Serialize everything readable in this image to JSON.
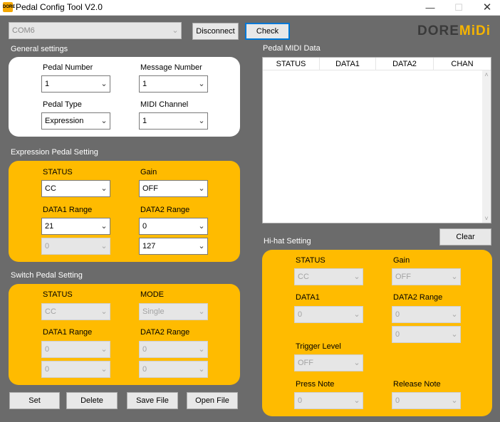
{
  "window": {
    "title": "Pedal Config Tool V2.0",
    "icon_text": "DORE",
    "minimize": "—",
    "maximize": "☐",
    "close": "✕"
  },
  "toolbar": {
    "com_port": "COM6",
    "disconnect_label": "Disconnect",
    "check_label": "Check"
  },
  "logo": {
    "part1": "DORE",
    "part2": "MiDi"
  },
  "general": {
    "title": "General settings",
    "pedal_number_label": "Pedal Number",
    "pedal_number_value": "1",
    "message_number_label": "Message Number",
    "message_number_value": "1",
    "pedal_type_label": "Pedal Type",
    "pedal_type_value": "Expression",
    "midi_channel_label": "MIDI Channel",
    "midi_channel_value": "1"
  },
  "expression": {
    "title": "Expression Pedal Setting",
    "status_label": "STATUS",
    "status_value": "CC",
    "gain_label": "Gain",
    "gain_value": "OFF",
    "data1_label": "DATA1 Range",
    "data1_min": "21",
    "data1_max": "0",
    "data2_label": "DATA2 Range",
    "data2_min": "0",
    "data2_max": "127"
  },
  "switch": {
    "title": "Switch Pedal Setting",
    "status_label": "STATUS",
    "status_value": "CC",
    "mode_label": "MODE",
    "mode_value": "Single",
    "data1_label": "DATA1 Range",
    "data1_min": "0",
    "data1_max": "0",
    "data2_label": "DATA2 Range",
    "data2_min": "0",
    "data2_max": "0"
  },
  "actions": {
    "set": "Set",
    "delete": "Delete",
    "save_file": "Save File",
    "open_file": "Open File"
  },
  "midi_data": {
    "title": "Pedal MIDI Data",
    "columns": [
      "STATUS",
      "DATA1",
      "DATA2",
      "CHAN"
    ],
    "scroll_up": "˄",
    "scroll_down": "˅",
    "clear_label": "Clear"
  },
  "hihat": {
    "title": "Hi-hat Setting",
    "status_label": "STATUS",
    "status_value": "CC",
    "gain_label": "Gain",
    "gain_value": "OFF",
    "data1_label": "DATA1",
    "data1_value": "0",
    "data2_label": "DATA2 Range",
    "data2_min": "0",
    "data2_max": "0",
    "trigger_label": "Trigger Level",
    "trigger_value": "OFF",
    "press_label": "Press Note",
    "press_value": "0",
    "release_label": "Release Note",
    "release_value": "0"
  },
  "combo_arrow": "⌄",
  "colors": {
    "panel_yellow": "#ffbb00",
    "background": "#6b6b6b",
    "logo_accent": "#f6b400"
  }
}
